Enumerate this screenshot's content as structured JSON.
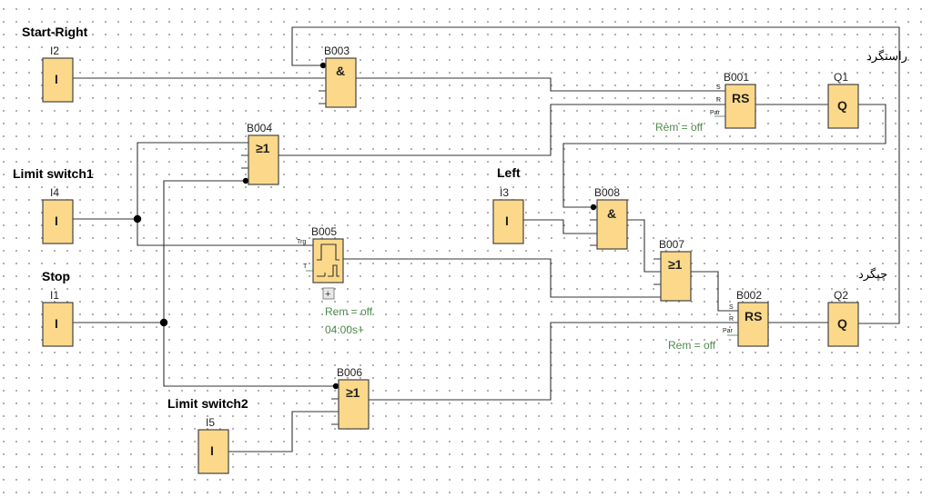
{
  "inputs": {
    "i2": {
      "name": "Start-Right",
      "id": "I2",
      "symbol": "I"
    },
    "i4": {
      "name": "Limit switch1",
      "id": "I4",
      "symbol": "I"
    },
    "i1": {
      "name": "Stop",
      "id": "I1",
      "symbol": "I"
    },
    "i5": {
      "name": "Limit switch2",
      "id": "I5",
      "symbol": "I"
    },
    "i3": {
      "name": "Left",
      "id": "I3",
      "symbol": "I"
    }
  },
  "blocks": {
    "b003": {
      "id": "B003",
      "symbol": "&"
    },
    "b004": {
      "id": "B004",
      "symbol": "≥1"
    },
    "b005": {
      "id": "B005",
      "pin_trg": "Trg",
      "pin_t": "T",
      "rem": "Rem = off",
      "time": "04:00s+",
      "expand": "+"
    },
    "b006": {
      "id": "B006",
      "symbol": "≥1"
    },
    "b008": {
      "id": "B008",
      "symbol": "&"
    },
    "b007": {
      "id": "B007",
      "symbol": "≥1"
    },
    "b001": {
      "id": "B001",
      "symbol": "RS",
      "pin_s": "S",
      "pin_r": "R",
      "pin_par": "Par",
      "rem": "Rem = off"
    },
    "b002": {
      "id": "B002",
      "symbol": "RS",
      "pin_s": "S",
      "pin_r": "R",
      "pin_par": "Par",
      "rem": "Rem = off"
    }
  },
  "outputs": {
    "q1": {
      "name": "راستگرد",
      "id": "Q1",
      "symbol": "Q"
    },
    "q2": {
      "name": "چپگرد",
      "id": "Q2",
      "symbol": "Q"
    }
  },
  "colors": {
    "block_fill": "#fcd98a",
    "param_text": "#4e8a4e"
  }
}
